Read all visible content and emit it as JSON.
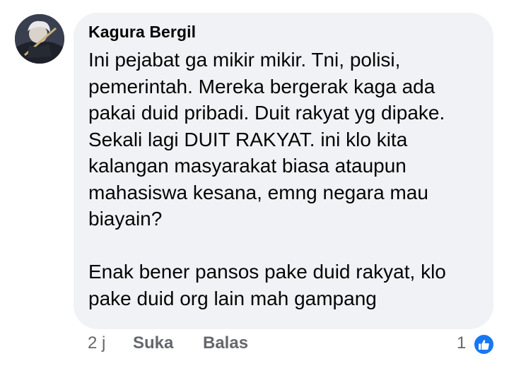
{
  "comment": {
    "author": "Kagura Bergil",
    "lines": [
      "Ini pejabat ga mikir mikir. Tni, polisi,",
      "pemerintah. Mereka bergerak kaga ada",
      "pakai duid pribadi. Duit rakyat yg dipake.",
      "Sekali lagi DUIT RAKYAT. ini klo kita",
      "kalangan masyarakat biasa ataupun",
      "mahasiswa kesana, emng negara mau",
      "biayain?",
      "",
      "Enak bener pansos pake duid rakyat, klo",
      "pake duid org lain mah gampang"
    ]
  },
  "actions": {
    "time": "2 j",
    "like_label": "Suka",
    "reply_label": "Balas"
  },
  "reactions": {
    "count": "1",
    "icon": "thumbs-up-icon",
    "color": "#1877f2"
  },
  "colors": {
    "bubble_bg": "#f0f2f5",
    "text": "#050505",
    "meta_text": "#65676b"
  }
}
